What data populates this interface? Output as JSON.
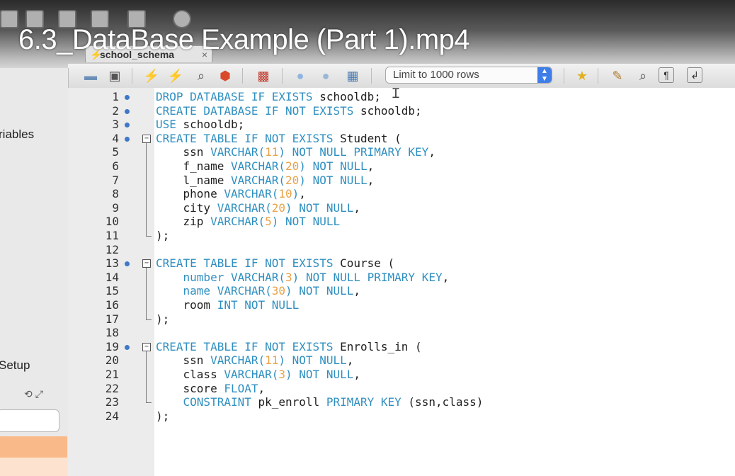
{
  "video_title": "6.3_DataBase Example (Part 1).mp4",
  "tab": {
    "label": "school_schema",
    "close": "×"
  },
  "toolbar": {
    "limit_select": "Limit to 1000 rows",
    "icons": [
      "open-folder-icon",
      "save-icon",
      "execute-icon",
      "execute-current-icon",
      "explain-icon",
      "stop-icon",
      "toggle-output-icon",
      "commit-icon",
      "rollback-icon",
      "autocommit-icon",
      "bookmark-icon",
      "beautify-icon",
      "find-icon",
      "invisible-chars-icon",
      "wrap-icon"
    ]
  },
  "sidebar": {
    "variables_label": "riables",
    "setup_label": "Setup"
  },
  "editor": {
    "lines": [
      {
        "n": "1",
        "dot": true,
        "fold": "",
        "tokens": [
          {
            "t": "DROP DATABASE IF EXISTS ",
            "k": "kw"
          },
          {
            "t": "schooldb;",
            "k": "txt"
          }
        ]
      },
      {
        "n": "2",
        "dot": true,
        "fold": "",
        "tokens": [
          {
            "t": "CREATE DATABASE IF NOT EXISTS ",
            "k": "kw"
          },
          {
            "t": "schooldb;",
            "k": "txt"
          }
        ]
      },
      {
        "n": "3",
        "dot": true,
        "fold": "",
        "tokens": [
          {
            "t": "USE ",
            "k": "kw"
          },
          {
            "t": "schooldb;",
            "k": "txt"
          }
        ]
      },
      {
        "n": "4",
        "dot": true,
        "fold": "open",
        "tokens": [
          {
            "t": "CREATE TABLE IF NOT EXISTS ",
            "k": "kw"
          },
          {
            "t": "Student (",
            "k": "txt"
          }
        ]
      },
      {
        "n": "5",
        "dot": false,
        "fold": "",
        "tokens": [
          {
            "t": "    ssn ",
            "k": "txt"
          },
          {
            "t": "VARCHAR(",
            "k": "kw"
          },
          {
            "t": "11",
            "k": "num"
          },
          {
            "t": ") NOT NULL PRIMARY KEY",
            "k": "kw"
          },
          {
            "t": ",",
            "k": "txt"
          }
        ]
      },
      {
        "n": "6",
        "dot": false,
        "fold": "",
        "tokens": [
          {
            "t": "    f_name ",
            "k": "txt"
          },
          {
            "t": "VARCHAR(",
            "k": "kw"
          },
          {
            "t": "20",
            "k": "num"
          },
          {
            "t": ") NOT NULL",
            "k": "kw"
          },
          {
            "t": ",",
            "k": "txt"
          }
        ]
      },
      {
        "n": "7",
        "dot": false,
        "fold": "",
        "tokens": [
          {
            "t": "    l_name ",
            "k": "txt"
          },
          {
            "t": "VARCHAR(",
            "k": "kw"
          },
          {
            "t": "20",
            "k": "num"
          },
          {
            "t": ") NOT NULL",
            "k": "kw"
          },
          {
            "t": ",",
            "k": "txt"
          }
        ]
      },
      {
        "n": "8",
        "dot": false,
        "fold": "",
        "tokens": [
          {
            "t": "    phone ",
            "k": "txt"
          },
          {
            "t": "VARCHAR(",
            "k": "kw"
          },
          {
            "t": "10",
            "k": "num"
          },
          {
            "t": ")",
            "k": "kw"
          },
          {
            "t": ",",
            "k": "txt"
          }
        ]
      },
      {
        "n": "9",
        "dot": false,
        "fold": "",
        "tokens": [
          {
            "t": "    city ",
            "k": "txt"
          },
          {
            "t": "VARCHAR(",
            "k": "kw"
          },
          {
            "t": "20",
            "k": "num"
          },
          {
            "t": ") NOT NULL",
            "k": "kw"
          },
          {
            "t": ",",
            "k": "txt"
          }
        ]
      },
      {
        "n": "10",
        "dot": false,
        "fold": "",
        "tokens": [
          {
            "t": "    zip ",
            "k": "txt"
          },
          {
            "t": "VARCHAR(",
            "k": "kw"
          },
          {
            "t": "5",
            "k": "num"
          },
          {
            "t": ") NOT NULL",
            "k": "kw"
          }
        ]
      },
      {
        "n": "11",
        "dot": false,
        "fold": "end",
        "tokens": [
          {
            "t": ");",
            "k": "txt"
          }
        ]
      },
      {
        "n": "12",
        "dot": false,
        "fold": "",
        "tokens": []
      },
      {
        "n": "13",
        "dot": true,
        "fold": "open",
        "tokens": [
          {
            "t": "CREATE TABLE IF NOT EXISTS ",
            "k": "kw"
          },
          {
            "t": "Course (",
            "k": "txt"
          }
        ]
      },
      {
        "n": "14",
        "dot": false,
        "fold": "",
        "tokens": [
          {
            "t": "    number VARCHAR(",
            "k": "kw"
          },
          {
            "t": "3",
            "k": "num"
          },
          {
            "t": ") NOT NULL PRIMARY KEY",
            "k": "kw"
          },
          {
            "t": ",",
            "k": "txt"
          }
        ]
      },
      {
        "n": "15",
        "dot": false,
        "fold": "",
        "tokens": [
          {
            "t": "    name VARCHAR(",
            "k": "kw"
          },
          {
            "t": "30",
            "k": "num"
          },
          {
            "t": ") NOT NULL",
            "k": "kw"
          },
          {
            "t": ",",
            "k": "txt"
          }
        ]
      },
      {
        "n": "16",
        "dot": false,
        "fold": "",
        "tokens": [
          {
            "t": "    room ",
            "k": "txt"
          },
          {
            "t": "INT NOT NULL",
            "k": "kw"
          }
        ]
      },
      {
        "n": "17",
        "dot": false,
        "fold": "end",
        "tokens": [
          {
            "t": ");",
            "k": "txt"
          }
        ]
      },
      {
        "n": "18",
        "dot": false,
        "fold": "",
        "tokens": []
      },
      {
        "n": "19",
        "dot": true,
        "fold": "open",
        "tokens": [
          {
            "t": "CREATE TABLE IF NOT EXISTS ",
            "k": "kw"
          },
          {
            "t": "Enrolls_in (",
            "k": "txt"
          }
        ]
      },
      {
        "n": "20",
        "dot": false,
        "fold": "",
        "tokens": [
          {
            "t": "    ssn ",
            "k": "txt"
          },
          {
            "t": "VARCHAR(",
            "k": "kw"
          },
          {
            "t": "11",
            "k": "num"
          },
          {
            "t": ") NOT NULL",
            "k": "kw"
          },
          {
            "t": ",",
            "k": "txt"
          }
        ]
      },
      {
        "n": "21",
        "dot": false,
        "fold": "",
        "tokens": [
          {
            "t": "    class ",
            "k": "txt"
          },
          {
            "t": "VARCHAR(",
            "k": "kw"
          },
          {
            "t": "3",
            "k": "num"
          },
          {
            "t": ") NOT NULL",
            "k": "kw"
          },
          {
            "t": ",",
            "k": "txt"
          }
        ]
      },
      {
        "n": "22",
        "dot": false,
        "fold": "",
        "tokens": [
          {
            "t": "    score ",
            "k": "txt"
          },
          {
            "t": "FLOAT",
            "k": "kw"
          },
          {
            "t": ",",
            "k": "txt"
          }
        ]
      },
      {
        "n": "23",
        "dot": false,
        "fold": "end",
        "tokens": [
          {
            "t": "    CONSTRAINT ",
            "k": "kw"
          },
          {
            "t": "pk_enroll ",
            "k": "txt"
          },
          {
            "t": "PRIMARY KEY ",
            "k": "kw"
          },
          {
            "t": "(ssn,class)",
            "k": "txt"
          }
        ]
      },
      {
        "n": "24",
        "dot": false,
        "fold": "",
        "tokens": [
          {
            "t": ");",
            "k": "txt"
          }
        ]
      }
    ]
  },
  "colors": {
    "keyword": "#2f8fc0",
    "number": "#e8a24a",
    "text": "#1e1e1e",
    "selection": "#f9b989",
    "dot": "#3f78c8"
  }
}
